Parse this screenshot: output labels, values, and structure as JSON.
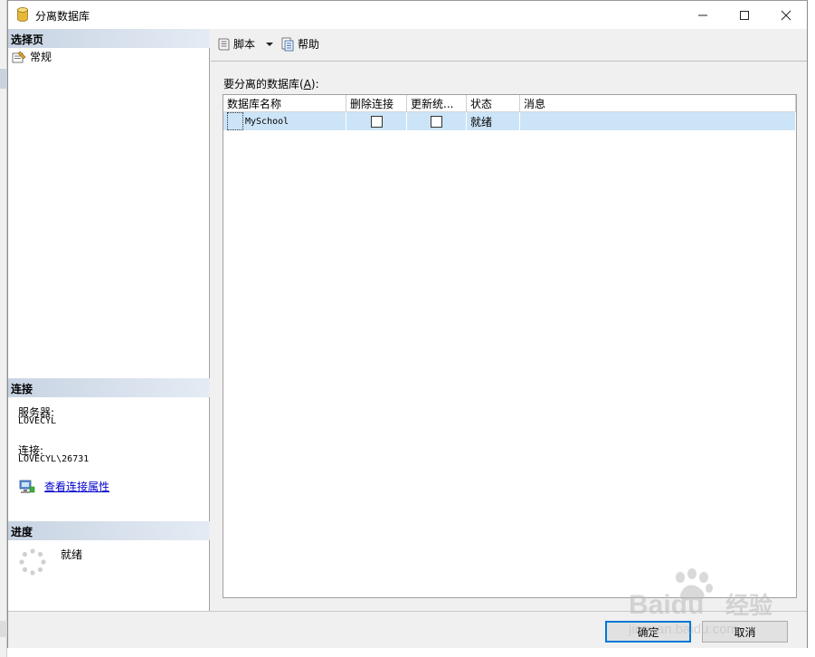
{
  "window": {
    "title": "分离数据库"
  },
  "left_panel": {
    "select_page_header": "选择页",
    "nav_items": [
      {
        "label": "常规"
      }
    ],
    "connection_header": "连接",
    "server_label": "服务器:",
    "server_value": "LOVECYL",
    "connection_label": "连接:",
    "connection_value": "LOVECYL\\26731",
    "view_connection_properties": "查看连接属性",
    "progress_header": "进度",
    "progress_status": "就绪"
  },
  "toolbar": {
    "script_label": "脚本",
    "help_label": "帮助"
  },
  "main": {
    "grid_label_prefix": "要分离的数据库(",
    "grid_label_accel": "A",
    "grid_label_suffix": "):",
    "columns": [
      "数据库名称",
      "删除连接",
      "更新统...",
      "状态",
      "消息"
    ],
    "rows": [
      {
        "name": "MySchool",
        "drop_connections": false,
        "update_stats": false,
        "status": "就绪",
        "message": ""
      }
    ]
  },
  "footer": {
    "ok_label": "确定",
    "cancel_label": "取消"
  },
  "watermark": {
    "brand": "Baidu",
    "suffix": "经验",
    "url": "jingyan.baidu.com"
  },
  "colors": {
    "header_gradient_start": "#c8d4e3",
    "selected_row": "#cce4f7",
    "link": "#0000cc",
    "ok_border": "#0078d7"
  }
}
